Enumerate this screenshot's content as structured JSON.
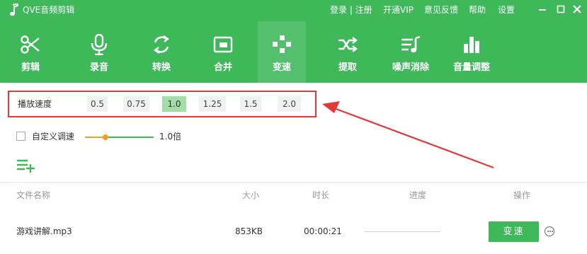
{
  "app": {
    "title": "QVE音频剪辑",
    "logo_icon": "music-note-icon"
  },
  "topnav": {
    "login": "登录 | 注册",
    "vip": "开通VIP",
    "feedback": "意见反馈",
    "help": "帮助",
    "settings": "设置"
  },
  "window_controls": [
    "minimize-icon",
    "maximize-icon",
    "close-icon"
  ],
  "tools": [
    {
      "label": "剪辑",
      "icon": "scissors-icon"
    },
    {
      "label": "录音",
      "icon": "microphone-icon"
    },
    {
      "label": "转换",
      "icon": "convert-icon"
    },
    {
      "label": "合并",
      "icon": "merge-icon"
    },
    {
      "label": "变速",
      "icon": "speed-icon",
      "active": true
    },
    {
      "label": "提取",
      "icon": "extract-icon"
    },
    {
      "label": "噪声消除",
      "icon": "noise-removal-icon"
    },
    {
      "label": "音量调整",
      "icon": "volume-icon"
    }
  ],
  "speed": {
    "label": "播放速度",
    "options": [
      "0.5",
      "0.75",
      "1.0",
      "1.25",
      "1.5",
      "2.0"
    ],
    "selected": "1.0"
  },
  "custom_speed": {
    "checkbox_label": "自定义调速",
    "checked": false,
    "value_label": "1.0倍",
    "slider_fraction": 0.3
  },
  "add_list_icon": "add-list-icon",
  "table": {
    "headers": {
      "name": "文件名称",
      "size": "大小",
      "duration": "时长",
      "progress": "进度",
      "actions": "操作"
    },
    "rows": [
      {
        "name": "游戏讲解.mp3",
        "size": "853KB",
        "duration": "00:00:21",
        "progress": 0,
        "action": "变速",
        "more_icon": "more-icon"
      }
    ]
  },
  "colors": {
    "brand_green": "#3fb85a",
    "active_tab": "#54c06d",
    "highlight_red": "#e03a3a",
    "selected_speed": "#a5dca7",
    "slider_orange": "#f0a020"
  }
}
